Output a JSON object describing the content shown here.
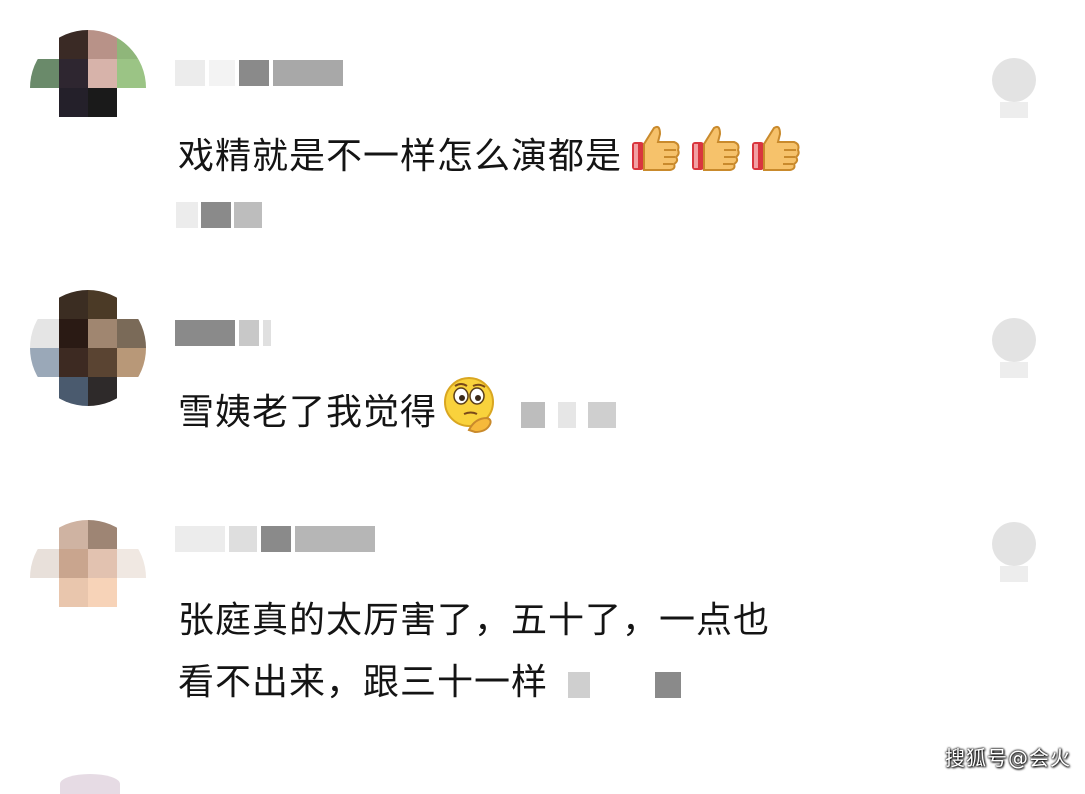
{
  "comments": [
    {
      "text": "戏精就是不一样怎么演都是",
      "emoji": "thumbs-up x3"
    },
    {
      "text": "雪姨老了我觉得",
      "emoji": "thinking-face"
    },
    {
      "text_line1": "张庭真的太厉害了，五十了，一点也",
      "text_line2": "看不出来，跟三十一样"
    }
  ],
  "watermark": "搜狐号@会火",
  "colors": {
    "text": "#141414",
    "blur": "#d9d9d9",
    "thumb": "#f6c26b",
    "thumb_cuff": "#d9363e"
  }
}
